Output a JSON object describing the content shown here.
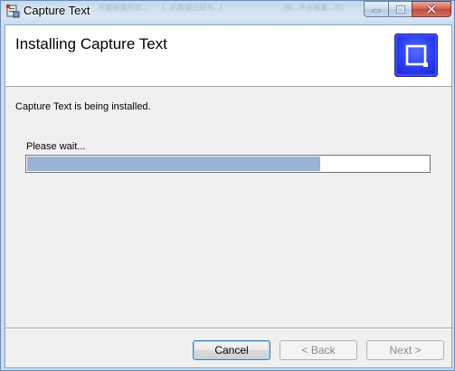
{
  "window": {
    "title": "Capture Text",
    "blurred_background_text": [
      "可能收集的您...",
      "(...的数据已经为...)",
      "(如...不会收集...可)"
    ],
    "caption_buttons": [
      "minimize-icon",
      "maximize-icon",
      "close-icon"
    ]
  },
  "banner": {
    "title": "Installing Capture Text",
    "logo_icon": "crop-square-icon"
  },
  "body": {
    "status": "Capture Text is being installed.",
    "progress_label": "Please wait...",
    "progress_fraction": 0.73
  },
  "buttons": {
    "cancel": "Cancel",
    "back": "< Back",
    "next": "Next >"
  },
  "colors": {
    "progress_fill": "#9ab3d3",
    "logo_blue": "#2a3df0"
  }
}
